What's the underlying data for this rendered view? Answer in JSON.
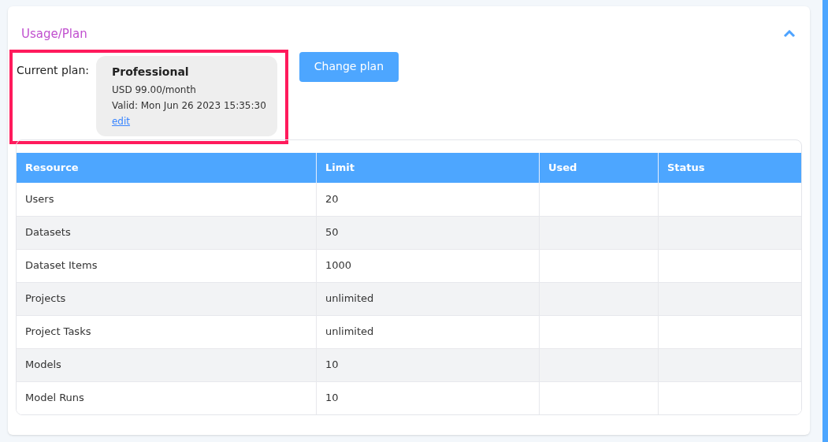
{
  "section": {
    "title": "Usage/Plan",
    "expanded": true
  },
  "plan": {
    "label": "Current plan:",
    "name": "Professional",
    "price": "USD 99.00/month",
    "valid": "Valid: Mon Jun 26 2023 15:35:30",
    "edit_link": "edit"
  },
  "change_plan_button": "Change plan",
  "table": {
    "columns": [
      "Resource",
      "Limit",
      "Used",
      "Status"
    ],
    "rows": [
      [
        "Users",
        "20"
      ],
      [
        "Datasets",
        "50"
      ],
      [
        "Dataset Items",
        "1000"
      ],
      [
        "Projects",
        "unlimited"
      ],
      [
        "Project Tasks",
        "unlimited"
      ],
      [
        "Models",
        "10"
      ],
      [
        "Model Runs",
        "10"
      ]
    ]
  }
}
